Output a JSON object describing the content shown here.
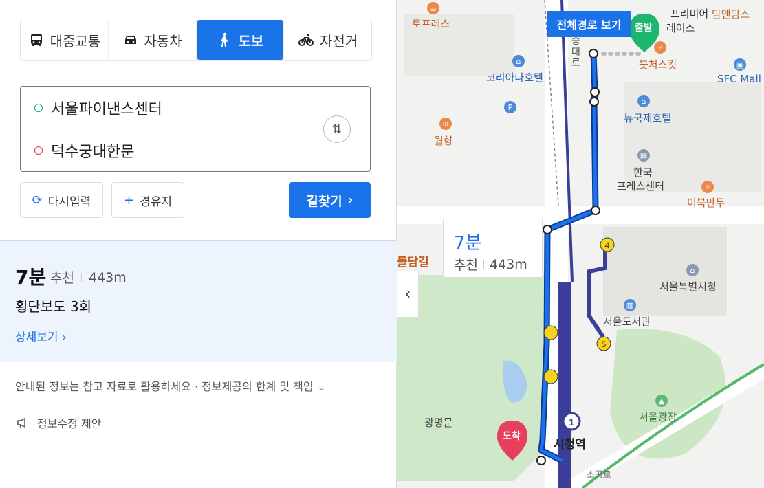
{
  "modes": [
    {
      "label": "대중교통",
      "icon": "bus-icon"
    },
    {
      "label": "자동차",
      "icon": "car-icon"
    },
    {
      "label": "도보",
      "icon": "walk-icon",
      "active": true
    },
    {
      "label": "자전거",
      "icon": "bike-icon"
    }
  ],
  "inputs": {
    "origin": "서울파이낸스센터",
    "destination": "덕수궁대한문"
  },
  "buttons": {
    "reset": "다시입력",
    "via": "경유지",
    "search": "길찾기"
  },
  "result": {
    "time": "7분",
    "tag": "추천",
    "distance": "443m",
    "crossings": "횡단보도 3회",
    "detail": "상세보기"
  },
  "notice": {
    "text": "안내된 정보는 참고 자료로 활용하세요",
    "link": "정보제공의 한계 및 책임"
  },
  "suggest": "정보수정 제안",
  "map": {
    "full_route": "전체경로 보기",
    "start_pin": "출발",
    "end_pin": "도착",
    "callout": {
      "time": "7분",
      "tag": "추천",
      "distance": "443m"
    },
    "labels": {
      "tofresh": "토프레스",
      "koreana": "코리아나호텔",
      "wolhyang": "월향",
      "premier": "프리미어",
      "place": "레이스",
      "tamntams": "탐앤탐스",
      "butchers": "붓처스컷",
      "sfc": "SFC Mall",
      "newkorea": "뉴국제호텔",
      "press1": "한국",
      "press2": "프레스센터",
      "ibuk": "이북만두",
      "cityhall": "서울특별시청",
      "library": "서울도서관",
      "plaza": "서울광장",
      "station": "시청역",
      "gwangmyeong": "광명문",
      "doldam": "돌담길",
      "sogong": "소공로",
      "road1": "세종대로",
      "road_v": "종대로"
    },
    "colors": {
      "route": "#1a73e8",
      "start": "#1db66f",
      "end": "#e8405b",
      "line1": "#3b3f9a"
    }
  }
}
